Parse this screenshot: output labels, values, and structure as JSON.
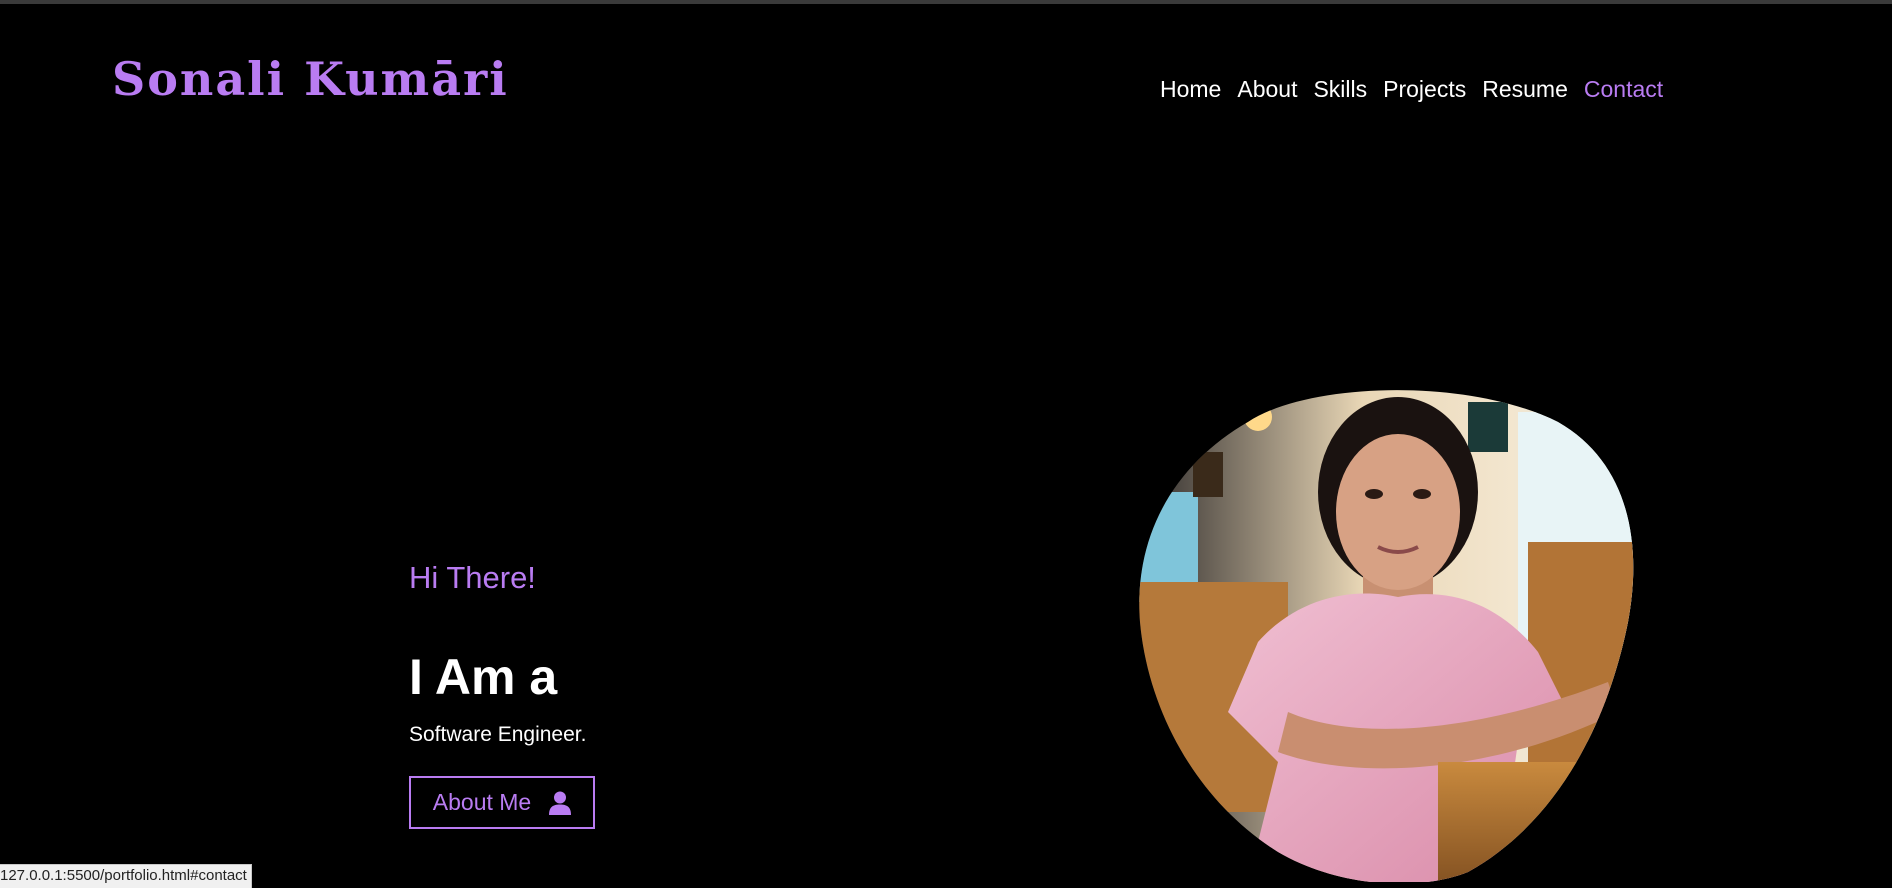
{
  "logo": {
    "text": "Sonali Kumāri"
  },
  "nav": {
    "items": [
      {
        "label": "Home"
      },
      {
        "label": "About"
      },
      {
        "label": "Skills"
      },
      {
        "label": "Projects"
      },
      {
        "label": "Resume"
      },
      {
        "label": "Contact"
      }
    ],
    "active": "Contact"
  },
  "hero": {
    "greeting": "Hi There!",
    "headline": "I Am a",
    "role": "Software Engineer.",
    "button_label": "About Me",
    "button_icon": "user-icon"
  },
  "profile_photo": {
    "icon": "profile-photo"
  },
  "status_bar": {
    "url": "127.0.0.1:5500/portfolio.html#contact"
  },
  "colors": {
    "accent": "#b97cf2",
    "background": "#000000",
    "text": "#ffffff"
  }
}
